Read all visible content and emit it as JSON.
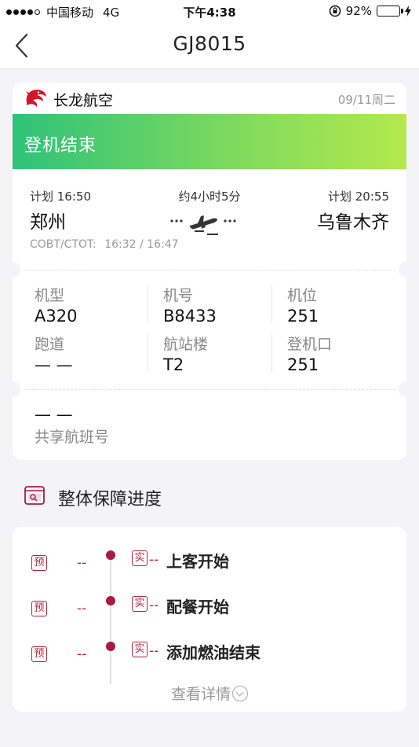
{
  "status_bar": {
    "carrier": "中国移动",
    "network": "4G",
    "time": "下午4:38",
    "battery": "92%",
    "battery_level": 0.92
  },
  "nav": {
    "title": "GJ8015",
    "back_icon": "chevron-left-icon"
  },
  "flight": {
    "airline": "长龙航空",
    "date": "09/11周二",
    "status": "登机结束",
    "status_colors": [
      "#2ec27a",
      "#b4e94c"
    ],
    "departure": {
      "plan": "计划 16:50",
      "city": "郑州"
    },
    "arrival": {
      "plan": "计划 20:55",
      "city": "乌鲁木齐"
    },
    "duration": "约4小时5分",
    "cobt_label": "COBT/CTOT:",
    "cobt_value": "16:32 / 16:47",
    "info": [
      {
        "label": "机型",
        "value": "A320"
      },
      {
        "label": "机号",
        "value": "B8433"
      },
      {
        "label": "机位",
        "value": "251"
      },
      {
        "label": "跑道",
        "value": "— —"
      },
      {
        "label": "航站楼",
        "value": "T2"
      },
      {
        "label": "登机口",
        "value": "251"
      }
    ],
    "share": {
      "label": "共享航班号",
      "value": "— —"
    }
  },
  "progress": {
    "title": "整体保障进度",
    "plan_badge": "预",
    "actual_badge": "实",
    "items": [
      {
        "plan": "--",
        "actual": "--",
        "label": "上客开始"
      },
      {
        "plan": "--",
        "actual": "--",
        "label": "配餐开始"
      },
      {
        "plan": "--",
        "actual": "--",
        "label": "添加燃油结束"
      }
    ],
    "details_link": "查看详情",
    "accent_color": "#b3243f"
  }
}
